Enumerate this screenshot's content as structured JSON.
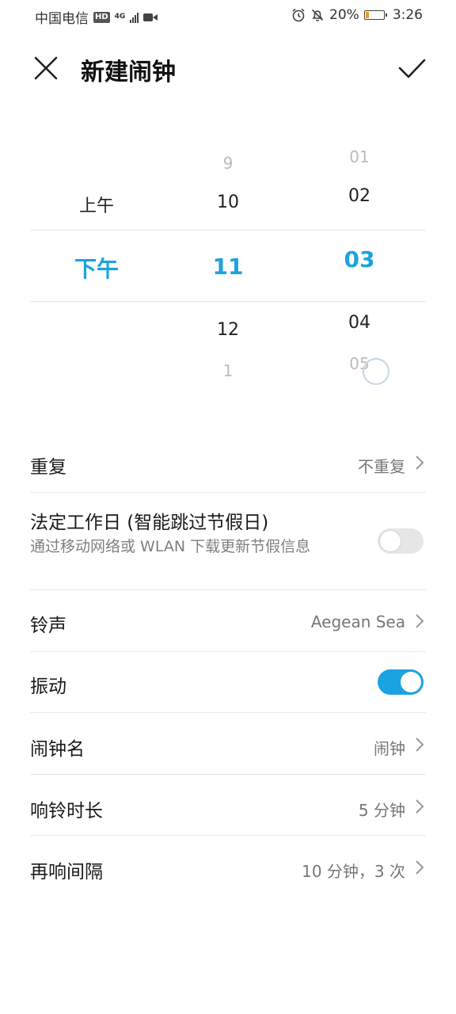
{
  "status_bar": {
    "carrier": "中国电信",
    "hd_badge": "HD",
    "network": "4G",
    "battery_percent": "20%",
    "battery_level": 0.2,
    "time": "3:26",
    "icons": [
      "hd-icon",
      "signal-icon",
      "video-icon",
      "alarm-icon",
      "mute-bell-icon",
      "battery-icon"
    ]
  },
  "header": {
    "title": "新建闹钟",
    "close_icon": "close-icon",
    "confirm_icon": "check-icon"
  },
  "picker": {
    "ampm": {
      "above": "上午",
      "selected": "下午"
    },
    "hours": {
      "far_above": "9",
      "above": "10",
      "selected": "11",
      "below": "12",
      "far_below": "1"
    },
    "minutes": {
      "far_above": "01",
      "above": "02",
      "selected": "03",
      "below": "04",
      "far_below": "05"
    },
    "accent": "#1aa3e0"
  },
  "settings": {
    "repeat": {
      "label": "重复",
      "value": "不重复"
    },
    "workday": {
      "label": "法定工作日 (智能跳过节假日)",
      "sub": "通过移动网络或 WLAN 下载更新节假信息",
      "enabled": false
    },
    "ringtone": {
      "label": "铃声",
      "value": "Aegean Sea"
    },
    "vibrate": {
      "label": "振动",
      "enabled": true
    },
    "name": {
      "label": "闹钟名",
      "value": "闹钟"
    },
    "duration": {
      "label": "响铃时长",
      "value": "5 分钟"
    },
    "snooze": {
      "label": "再响间隔",
      "value": "10 分钟，3 次"
    }
  }
}
